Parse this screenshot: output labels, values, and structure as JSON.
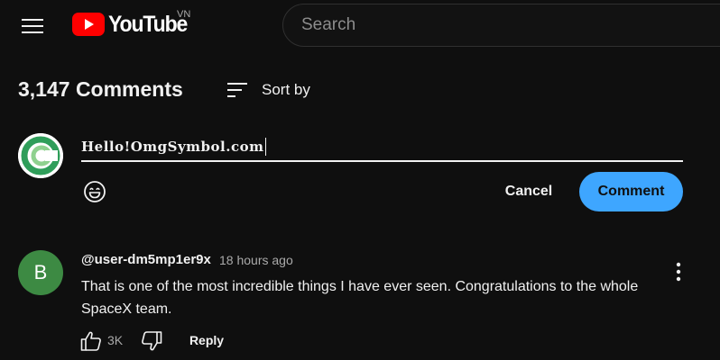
{
  "header": {
    "logo_text": "YouTube",
    "region": "VN",
    "search_placeholder": "Search"
  },
  "comments_section": {
    "count_label": "3,147 Comments",
    "sort_label": "Sort by"
  },
  "composer": {
    "input_value": "Hello!OmgSymbol.com",
    "cancel_label": "Cancel",
    "submit_label": "Comment"
  },
  "comment": {
    "avatar_letter": "B",
    "author": "@user-dm5mp1er9x",
    "time": "18 hours ago",
    "text": "That is one of the most incredible things I have ever seen. Congratulations to the whole SpaceX team.",
    "like_count": "3K",
    "reply_label": "Reply"
  },
  "colors": {
    "background": "#0f0f0f",
    "accent": "#3ea6ff",
    "brand_red": "#ff0000",
    "avatar_green": "#3d8a43"
  },
  "icons": [
    "menu-icon",
    "youtube-play-icon",
    "sort-icon",
    "emoji-icon",
    "more-vert-icon",
    "thumbs-up-icon",
    "thumbs-down-icon"
  ]
}
